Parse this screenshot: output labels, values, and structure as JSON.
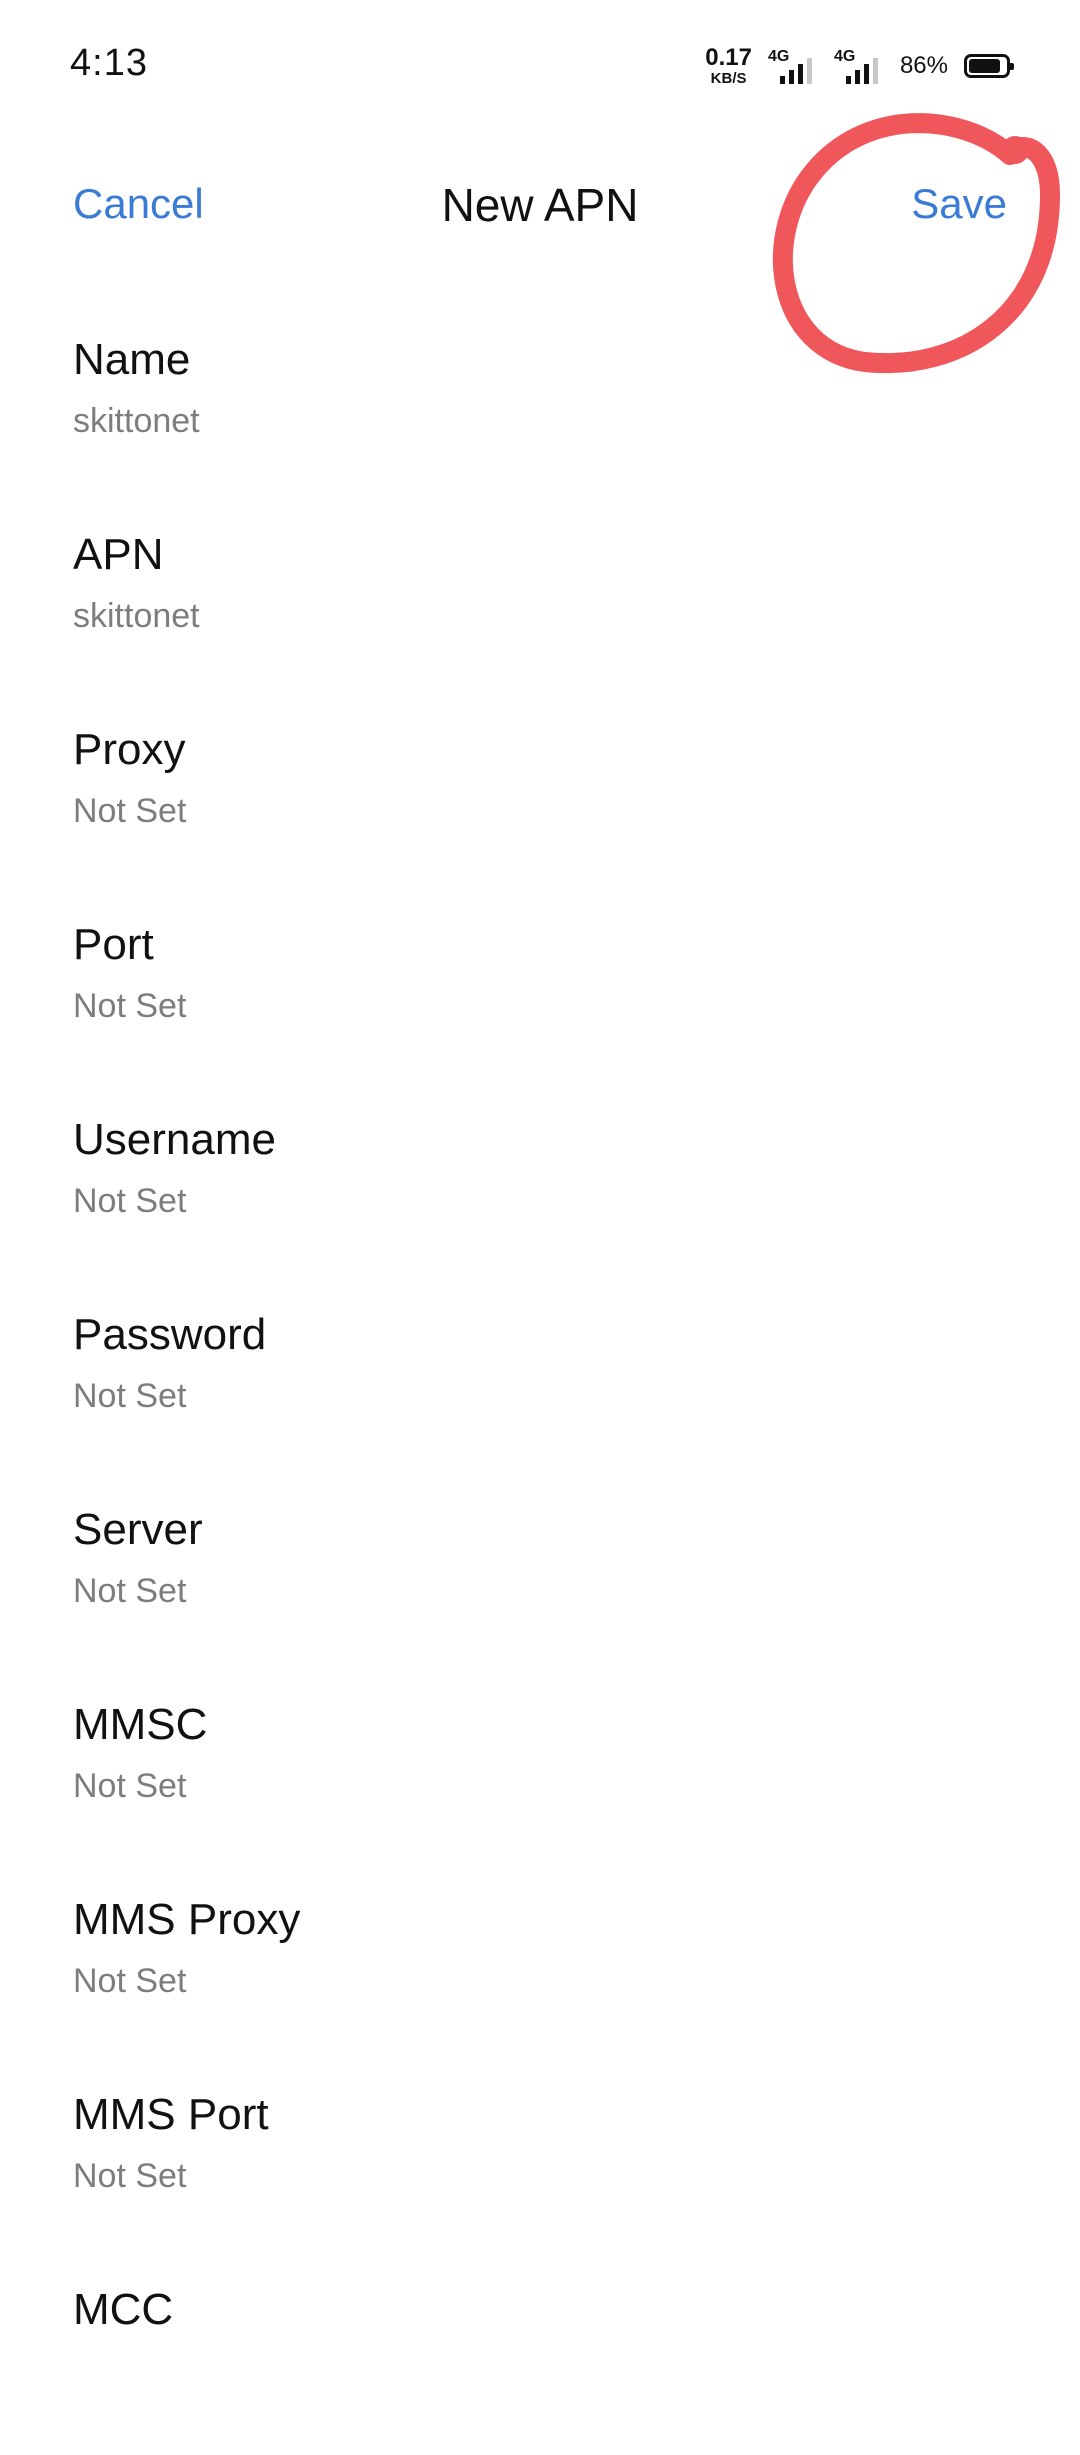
{
  "status_bar": {
    "time": "4:13",
    "net_speed_value": "0.17",
    "net_speed_unit": "KB/S",
    "sim1_type": "4G",
    "sim2_type": "4G",
    "battery_percent": "86%",
    "battery_level": 0.86,
    "icons": [
      "signal-sim1-icon",
      "signal-sim2-icon",
      "battery-icon"
    ]
  },
  "header": {
    "cancel_label": "Cancel",
    "title": "New APN",
    "save_label": "Save",
    "accent_color": "#3a7bd5",
    "annotation_color": "#f0575b"
  },
  "fields": [
    {
      "label": "Name",
      "value": "skittonet"
    },
    {
      "label": "APN",
      "value": "skittonet"
    },
    {
      "label": "Proxy",
      "value": "Not Set"
    },
    {
      "label": "Port",
      "value": "Not Set"
    },
    {
      "label": "Username",
      "value": "Not Set"
    },
    {
      "label": "Password",
      "value": "Not Set"
    },
    {
      "label": "Server",
      "value": "Not Set"
    },
    {
      "label": "MMSC",
      "value": "Not Set"
    },
    {
      "label": "MMS Proxy",
      "value": "Not Set"
    },
    {
      "label": "MMS Port",
      "value": "Not Set"
    },
    {
      "label": "MCC",
      "value": ""
    }
  ]
}
